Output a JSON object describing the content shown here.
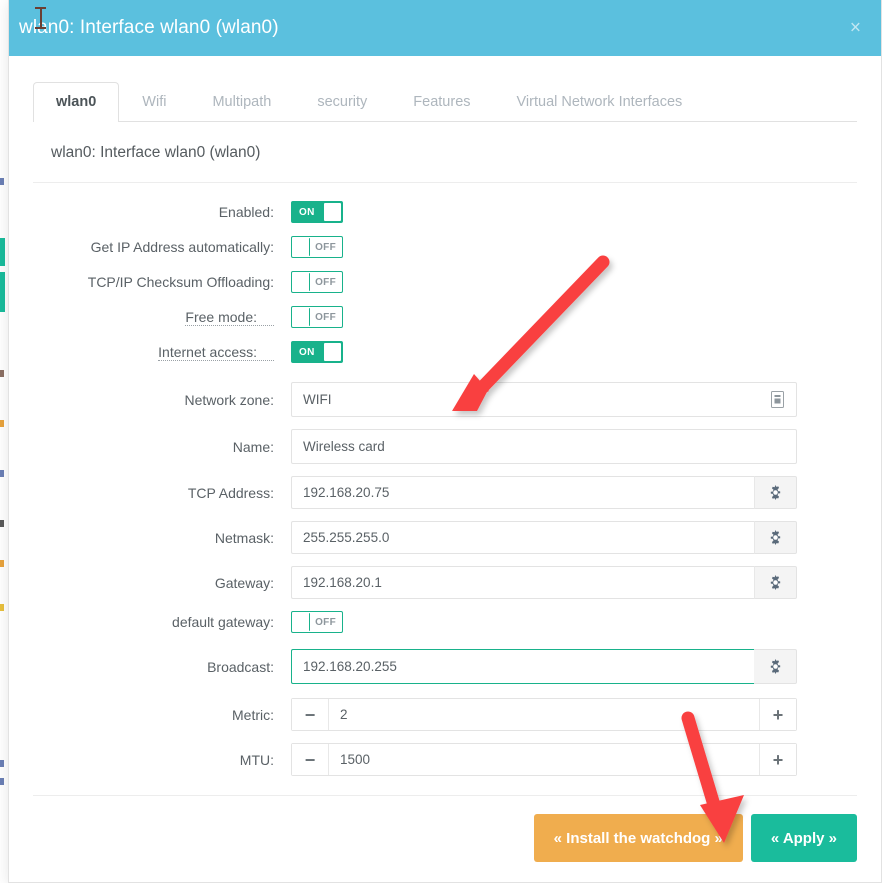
{
  "window": {
    "title": "wlan0: Interface wlan0 (wlan0)",
    "close_label": "×",
    "header_color": "#5bc0de"
  },
  "tabs": [
    {
      "label": "wlan0",
      "active": true
    },
    {
      "label": "Wifi",
      "active": false
    },
    {
      "label": "Multipath",
      "active": false
    },
    {
      "label": "security",
      "active": false
    },
    {
      "label": "Features",
      "active": false
    },
    {
      "label": "Virtual Network Interfaces",
      "active": false
    }
  ],
  "section": {
    "title": "wlan0: Interface wlan0 (wlan0)"
  },
  "switches": [
    {
      "label": "Enabled:",
      "state": "ON",
      "tooltip": false
    },
    {
      "label": "Get IP Address automatically:",
      "state": "OFF",
      "tooltip": false
    },
    {
      "label": "TCP/IP Checksum Offloading:",
      "state": "OFF",
      "tooltip": false
    },
    {
      "label": "Free mode:",
      "state": "OFF",
      "tooltip": true
    },
    {
      "label": "Internet access:",
      "state": "ON",
      "tooltip": true
    }
  ],
  "fields": {
    "network_zone": {
      "label": "Network zone:",
      "value": "WIFI",
      "icon": "device-list-icon"
    },
    "name": {
      "label": "Name:",
      "value": "Wireless card",
      "icon": null
    },
    "tcp_address": {
      "label": "TCP Address:",
      "value": "192.168.20.75",
      "icon": "gear-icon"
    },
    "netmask": {
      "label": "Netmask:",
      "value": "255.255.255.0",
      "icon": "gear-icon"
    },
    "gateway": {
      "label": "Gateway:",
      "value": "192.168.20.1",
      "icon": "gear-icon"
    },
    "broadcast": {
      "label": "Broadcast:",
      "value": "192.168.20.255",
      "icon": "gear-icon",
      "focused": true
    }
  },
  "default_gateway": {
    "label": "default gateway:",
    "state": "OFF"
  },
  "steppers": [
    {
      "label": "Metric:",
      "value": "2",
      "minus": "−",
      "plus": "+"
    },
    {
      "label": "MTU:",
      "value": "1500",
      "minus": "−",
      "plus": "+"
    }
  ],
  "footer": {
    "watchdog_label": "« Install the watchdog »",
    "apply_label": "« Apply »",
    "watchdog_color": "#f0ad4e",
    "apply_color": "#1abc9c"
  },
  "annotations": {
    "arrow_color": "#f94040",
    "arrow_name_field": "points-to-name-field",
    "arrow_apply_button": "points-to-apply-button"
  },
  "toggle_text": {
    "on": "ON",
    "off": "OFF"
  }
}
